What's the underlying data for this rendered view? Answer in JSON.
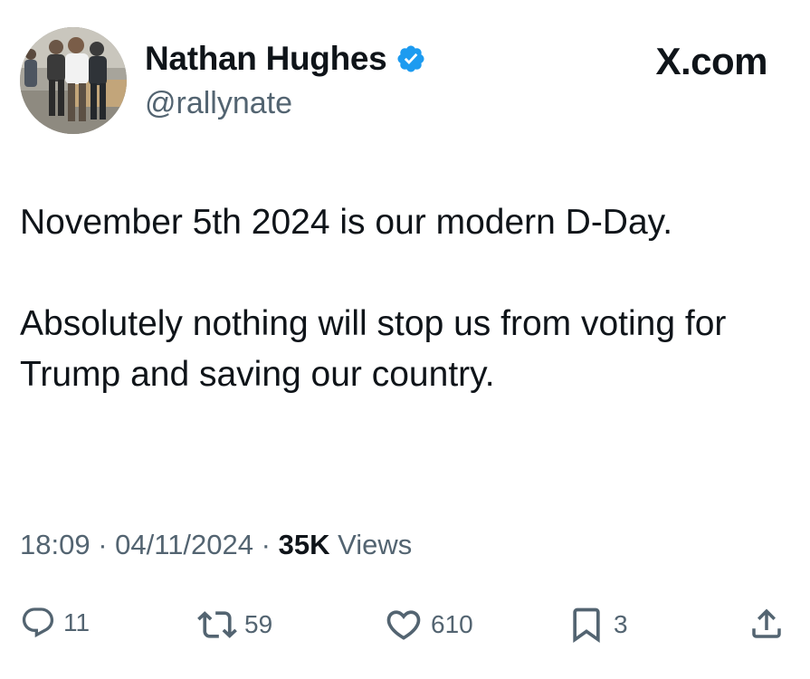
{
  "author": {
    "display_name": "Nathan Hughes",
    "handle": "@rallynate",
    "verified_icon": "verified-badge-icon",
    "avatar": "profile-photo"
  },
  "brand": {
    "label": "X.com"
  },
  "tweet": {
    "paragraphs": [
      "November 5th 2024 is our modern D-Day.",
      "Absolutely nothing will stop us from voting for Trump and saving our country."
    ]
  },
  "meta": {
    "time": "18:09",
    "date": "04/11/2024",
    "views_count": "35K",
    "views_label": "Views",
    "separator": "·"
  },
  "actions": {
    "replies": "11",
    "reposts": "59",
    "likes": "610",
    "bookmarks": "3"
  },
  "colors": {
    "text": "#0f1419",
    "muted": "#536471",
    "verified": "#1d9bf0"
  }
}
